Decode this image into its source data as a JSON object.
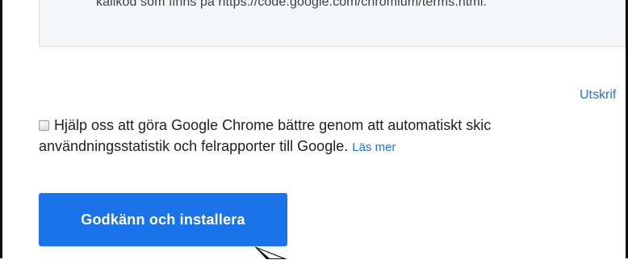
{
  "terms": {
    "text_fragment": "källkod som finns på https://code.google.com/chromium/terms.html."
  },
  "print_link": "Utskrif",
  "consent": {
    "line1": "Hjälp oss att göra Google Chrome bättre genom att automatiskt skic",
    "line2": "användningsstatistik och felrapporter till Google.",
    "learn_more": "Läs mer"
  },
  "accept_button": "Godkänn och installera",
  "colors": {
    "accent": "#1a73e8",
    "text": "#202124",
    "terms_background": "#f5f6f7"
  },
  "icons": [
    "mouse-pointer-icon"
  ]
}
